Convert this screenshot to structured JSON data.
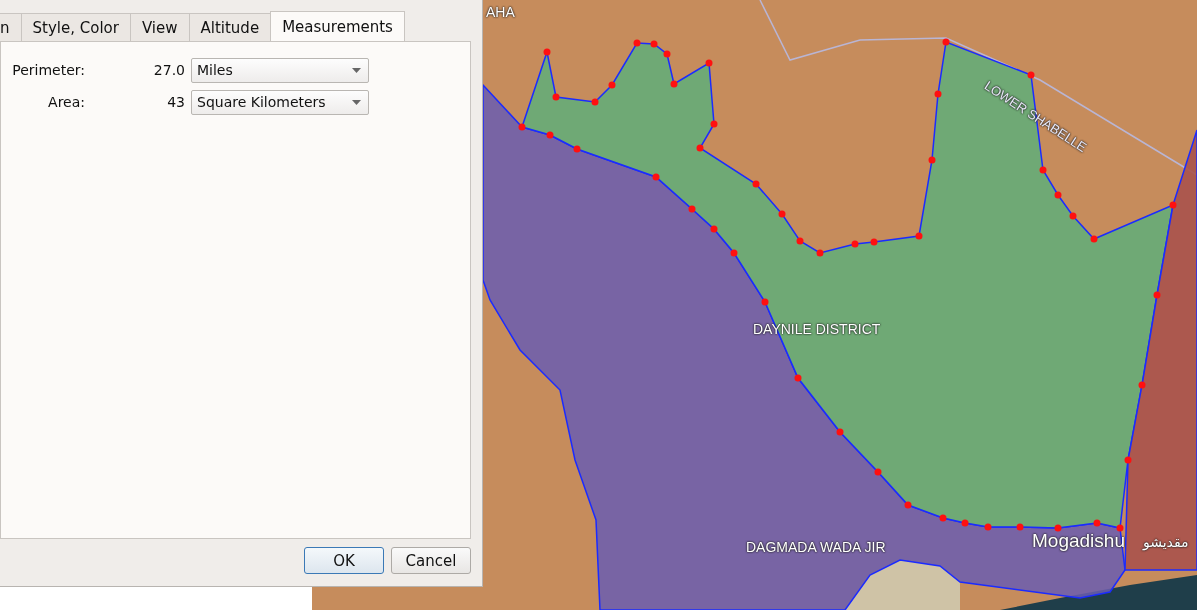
{
  "dialog": {
    "tabs": [
      {
        "label": "n",
        "selected": false
      },
      {
        "label": "Style, Color",
        "selected": false
      },
      {
        "label": "View",
        "selected": false
      },
      {
        "label": "Altitude",
        "selected": false
      },
      {
        "label": "Measurements",
        "selected": true
      }
    ],
    "measurements": [
      {
        "label": "Perimeter:",
        "value": "27.0",
        "unit": "Miles"
      },
      {
        "label": "Area:",
        "value": "43",
        "unit": "Square Kilometers"
      }
    ],
    "buttons": [
      {
        "label": "OK",
        "kind": "default"
      },
      {
        "label": "Cancel",
        "kind": "normal"
      }
    ]
  },
  "map": {
    "labels": [
      {
        "text": "AHA",
        "kind": "place"
      },
      {
        "text": "LOWER SHABELLE",
        "kind": "region"
      },
      {
        "text": "DAYNILE DISTRICT",
        "kind": "place"
      },
      {
        "text": "DAGMADA WADA JIR",
        "kind": "place"
      },
      {
        "text": "Mogadishu",
        "kind": "city"
      },
      {
        "text": "مقديشو",
        "kind": "city-native"
      }
    ]
  }
}
